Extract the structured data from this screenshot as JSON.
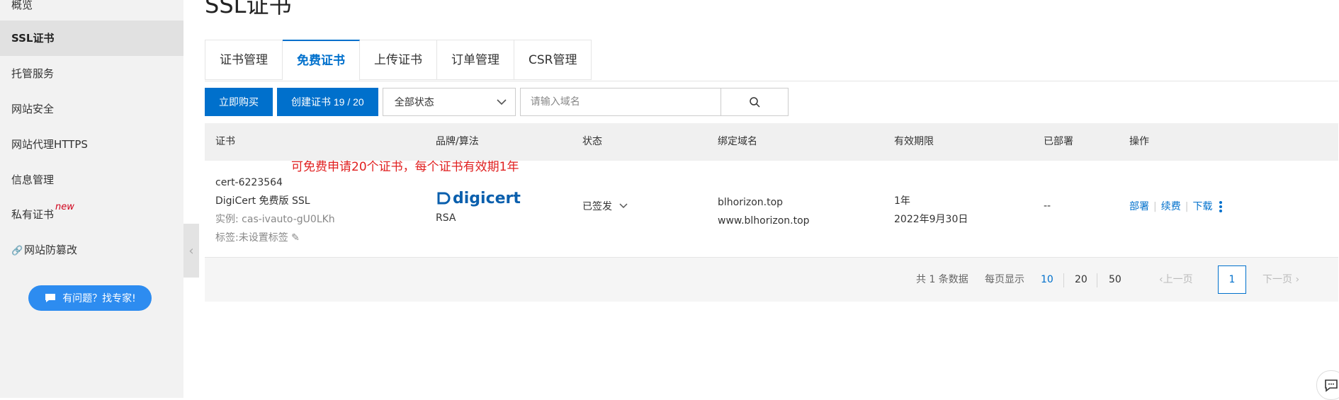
{
  "sidebar": {
    "items": [
      {
        "label": "概览"
      },
      {
        "label": "SSL证书"
      },
      {
        "label": "托管服务"
      },
      {
        "label": "网站安全"
      },
      {
        "label": "网站代理HTTPS"
      },
      {
        "label": "信息管理"
      },
      {
        "label": "私有证书",
        "tag": "new"
      },
      {
        "label": "网站防篡改"
      }
    ],
    "help_button": "有问题？找专家!"
  },
  "page": {
    "title": "SSL证书"
  },
  "tabs": [
    {
      "label": "证书管理"
    },
    {
      "label": "免费证书",
      "active": true
    },
    {
      "label": "上传证书"
    },
    {
      "label": "订单管理"
    },
    {
      "label": "CSR管理"
    }
  ],
  "toolbar": {
    "buy_label": "立即购买",
    "create_label": "创建证书 19 / 20",
    "status_select": "全部状态",
    "search_placeholder": "请输入域名"
  },
  "table": {
    "columns": [
      "证书",
      "品牌/算法",
      "状态",
      "绑定域名",
      "有效期限",
      "已部署",
      "操作"
    ],
    "annotation": "可免费申请20个证书，每个证书有效期1年",
    "rows": [
      {
        "cert_id": "cert-6223564",
        "cert_name": "DigiCert 免费版 SSL",
        "instance": "实例: cas-ivauto-gU0LKh",
        "tag": "标签:未设置标签",
        "brand": "digicert",
        "algorithm": "RSA",
        "status": "已签发",
        "domain_1": "blhorizon.top",
        "domain_2": "www.blhorizon.top",
        "validity": "1年",
        "expiry": "2022年9月30日",
        "deployed": "--",
        "actions": [
          "部署",
          "续费",
          "下载"
        ]
      }
    ]
  },
  "pagination": {
    "total": "共 1 条数据",
    "per_page_label": "每页显示",
    "sizes": [
      "10",
      "20",
      "50"
    ],
    "prev": "上一页",
    "current": "1",
    "next": "下一页"
  },
  "colors": {
    "accent": "#0070cc",
    "annotation": "#e02020",
    "help_button": "#2d8cf0"
  }
}
